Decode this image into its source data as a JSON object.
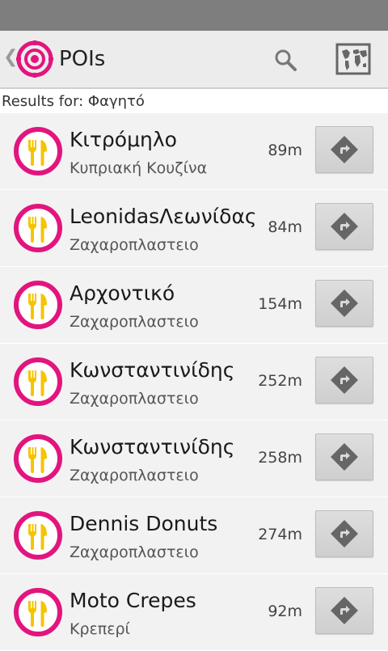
{
  "colors": {
    "brand": "#e2157e",
    "fork": "#f5c400",
    "status_bar": "#7e7e7e"
  },
  "action_bar": {
    "title": "POIs",
    "up_icon": "chevron-left-icon",
    "logo_icon": "target-logo-icon",
    "search_icon": "search-icon",
    "map_icon": "world-map-icon"
  },
  "results": {
    "label": "Results for: Φαγητό"
  },
  "pois": [
    {
      "name": "Κιτρόμηλο",
      "category": "Κυπριακή Κουζίνα",
      "distance": "89m",
      "icon": "fork-knife-icon"
    },
    {
      "name": "LeonidasΛεωνίδας",
      "category": "Ζαχαροπλαστειο",
      "distance": "84m",
      "icon": "fork-knife-icon"
    },
    {
      "name": "Αρχοντικό",
      "category": "Ζαχαροπλαστειο",
      "distance": "154m",
      "icon": "fork-knife-icon"
    },
    {
      "name": "Κωνσταντινίδης",
      "category": "Ζαχαροπλαστειο",
      "distance": "252m",
      "icon": "fork-knife-icon"
    },
    {
      "name": "Κωνσταντινίδης",
      "category": "Ζαχαροπλαστειο",
      "distance": "258m",
      "icon": "fork-knife-icon"
    },
    {
      "name": "Dennis Donuts",
      "category": "Ζαχαροπλαστειο",
      "distance": "274m",
      "icon": "fork-knife-icon"
    },
    {
      "name": "Moto Crepes",
      "category": "Κρεπερί",
      "distance": "92m",
      "icon": "fork-knife-icon"
    }
  ]
}
